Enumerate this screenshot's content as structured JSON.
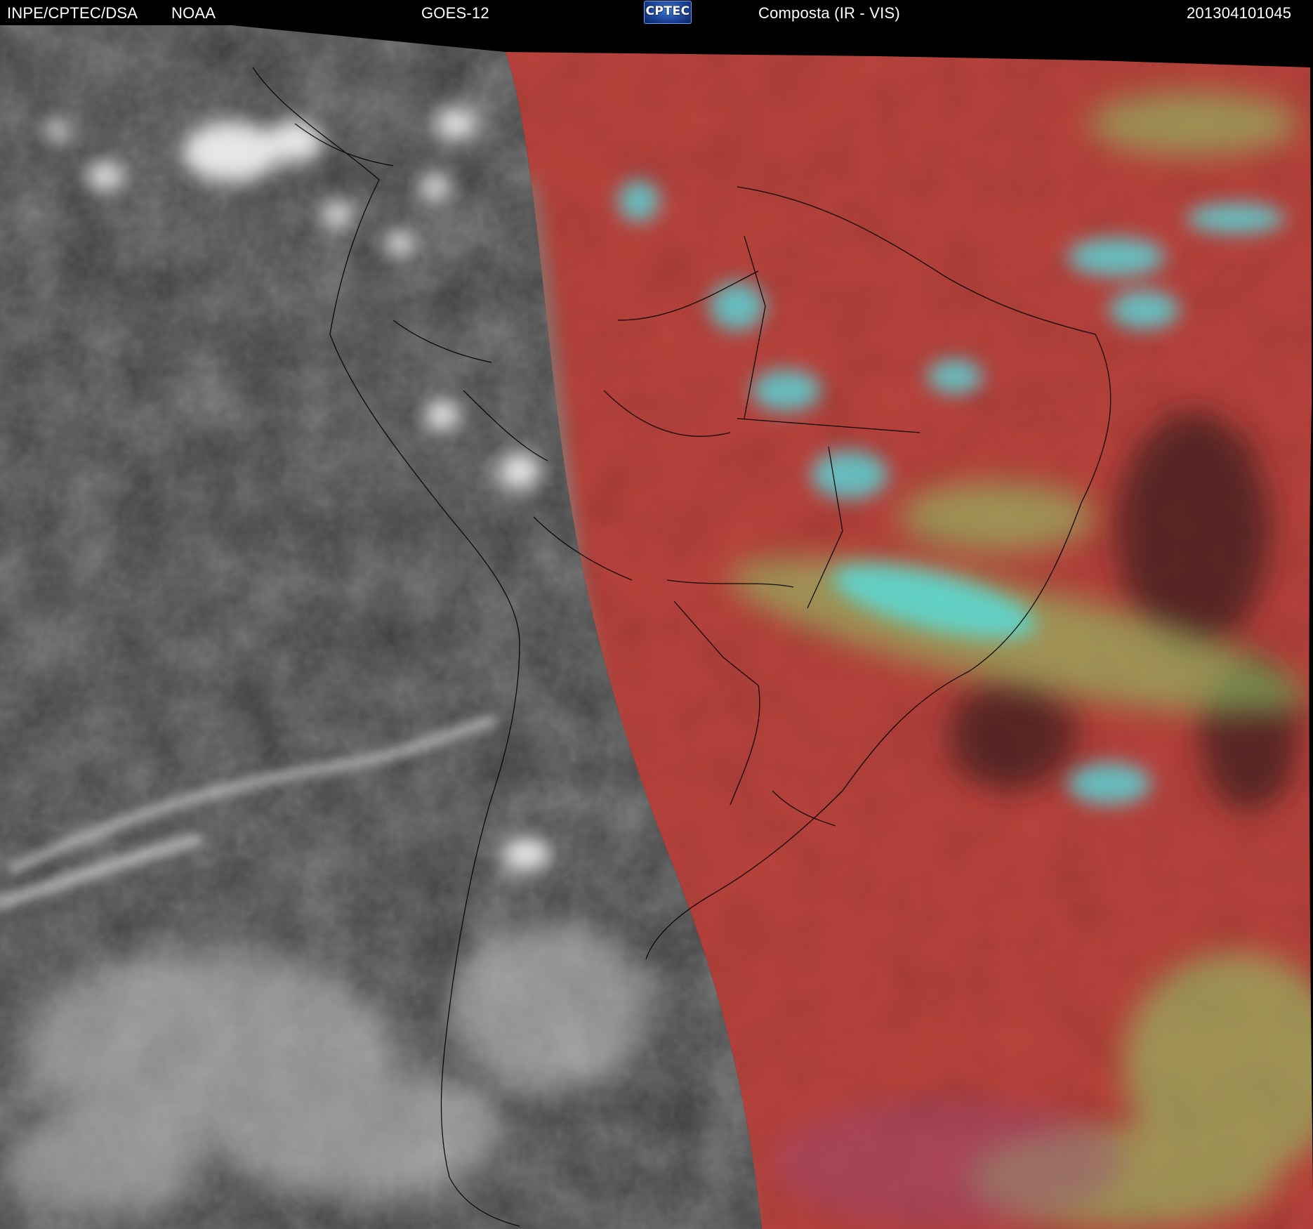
{
  "header": {
    "institution": "INPE/CPTEC/DSA",
    "agency": "NOAA",
    "satellite": "GOES-12",
    "logo_text": "CPTEC",
    "product": "Composta (IR - VIS)",
    "timestamp": "201304101045"
  },
  "colors": {
    "background": "#000000",
    "ir_gray": "#3a3a3a",
    "composite_red": "#b9423c",
    "cloud_cyan": "#4fe6ea",
    "cloud_green": "#8ed46a",
    "coastline": "#000000"
  }
}
